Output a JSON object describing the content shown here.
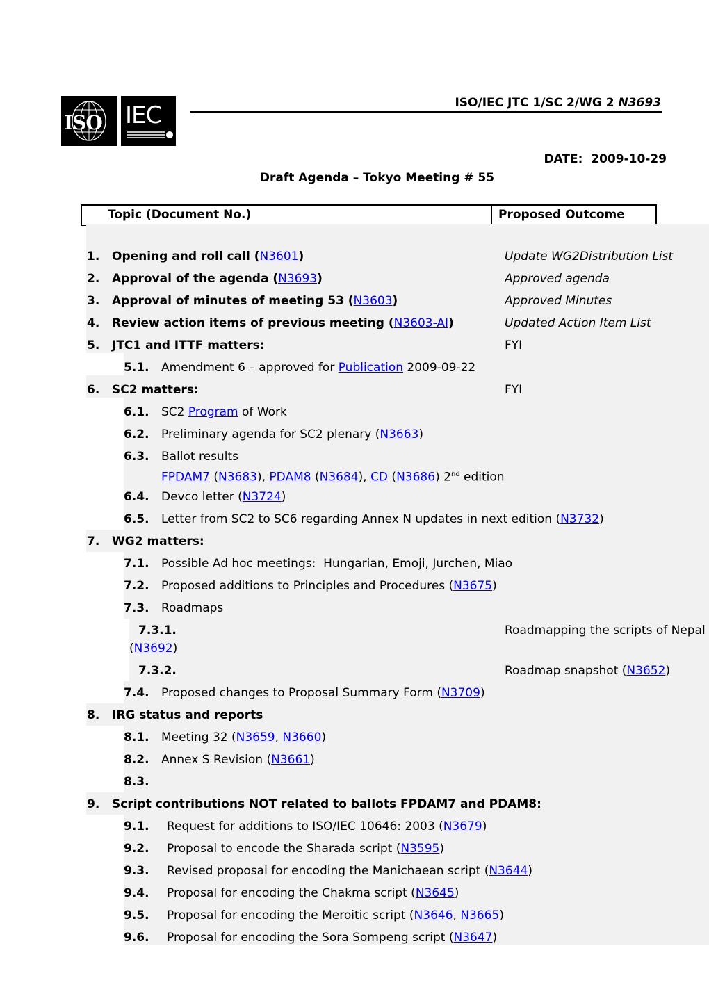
{
  "header": {
    "logos": [
      "ISO",
      "IEC"
    ],
    "doc_ref_prefix": "ISO/IEC JTC 1/SC 2/WG 2 ",
    "doc_ref_number": "N3693",
    "date_label": "DATE:",
    "date_value": "2009-10-29",
    "title": "Draft Agenda – Tokyo Meeting # 55"
  },
  "table_header": {
    "topic": "Topic (Document No.)",
    "outcome": "Proposed Outcome"
  },
  "colors": {
    "link": "#0000ee",
    "shade": "#f1f1f1"
  },
  "items": {
    "i1": {
      "num": "1.",
      "text": "Opening and roll call (",
      "link": "N3601",
      "close": ")",
      "outcome": "Update WG2Distribution List"
    },
    "i2": {
      "num": "2.",
      "text": "Approval of the agenda (",
      "link": "N3693",
      "close": ")",
      "outcome": "Approved agenda"
    },
    "i3": {
      "num": "3.",
      "text": "Approval of minutes of meeting 53 (",
      "link": "N3603",
      "close": ")",
      "outcome": "Approved Minutes"
    },
    "i4": {
      "num": "4.",
      "text": "Review action items of previous meeting (",
      "link": "N3603-AI",
      "close": ")",
      "outcome": "Updated Action Item List"
    },
    "i5": {
      "num": "5.",
      "text": "JTC1 and ITTF matters:",
      "outcome": "FYI"
    },
    "i5_1": {
      "num": "5.1.",
      "text": "Amendment 6 – approved for ",
      "link": "Publication",
      "after": " 2009-09-22"
    },
    "i6": {
      "num": "6.",
      "text": "SC2 matters:",
      "outcome": "FYI"
    },
    "i6_1": {
      "num": "6.1.",
      "text": "SC2 ",
      "link": "Program",
      "after": " of Work"
    },
    "i6_2": {
      "num": "6.2.",
      "text": "Preliminary agenda for SC2 plenary (",
      "link": "N3663",
      "close": ")"
    },
    "i6_3": {
      "num": "6.3.",
      "text": "Ballot results",
      "line2": {
        "l1": "FPDAM7",
        "l1d": "N3683",
        "l2": "PDAM8",
        "l2d": "N3684",
        "l3": "CD",
        "l3d": "N3686",
        "tail": " 2",
        "sup": "nd",
        "tail2": " edition"
      }
    },
    "i6_4": {
      "num": "6.4.",
      "text": "Devco letter (",
      "link": "N3724",
      "close": ")"
    },
    "i6_5": {
      "num": "6.5.",
      "text": "Letter from SC2 to SC6 regarding Annex N updates in next edition (",
      "link": "N3732",
      "close": ")"
    },
    "i7": {
      "num": "7.",
      "text": "WG2 matters:"
    },
    "i7_1": {
      "num": "7.1.",
      "text": "Possible Ad hoc meetings:  Hungarian, Emoji, Jurchen, Miao"
    },
    "i7_2": {
      "num": "7.2.",
      "text": "Proposed additions to Principles and Procedures (",
      "link": "N3675",
      "close": ")"
    },
    "i7_3": {
      "num": "7.3.",
      "text": "Roadmaps"
    },
    "i7_3_1": {
      "num": "7.3.1.",
      "text": "Roadmapping the scripts of Nepal",
      "open": "(",
      "link": "N3692",
      "close": ")"
    },
    "i7_3_2": {
      "num": "7.3.2.",
      "text": "Roadmap snapshot (",
      "link": "N3652",
      "close": ")"
    },
    "i7_4": {
      "num": "7.4.",
      "text": "Proposed changes to Proposal Summary Form (",
      "link": "N3709",
      "close": ")"
    },
    "i8": {
      "num": "8.",
      "text": "IRG status and reports"
    },
    "i8_1": {
      "num": "8.1.",
      "text": "Meeting 32 (",
      "link": "N3659",
      "sep": ", ",
      "link2": "N3660",
      "close": ")"
    },
    "i8_2": {
      "num": "8.2.",
      "text": "Annex S Revision (",
      "link": "N3661",
      "close": ")"
    },
    "i8_3": {
      "num": "8.3."
    },
    "i9": {
      "num": "9.",
      "text": "Script contributions NOT related to ballots FPDAM7 and PDAM8:"
    },
    "i9_1": {
      "num": "9.1.",
      "text": "Request for additions to ISO/IEC 10646: 2003 (",
      "link": "N3679",
      "close": ")"
    },
    "i9_2": {
      "num": "9.2.",
      "text": "Proposal to encode the Sharada script (",
      "link": "N3595",
      "close": ")"
    },
    "i9_3": {
      "num": "9.3.",
      "text": "Revised proposal for encoding the Manichaean script (",
      "link": "N3644",
      "close": ")"
    },
    "i9_4": {
      "num": "9.4.",
      "text": "Proposal for encoding the Chakma script (",
      "link": "N3645",
      "close": ")"
    },
    "i9_5": {
      "num": "9.5.",
      "text": "Proposal for encoding the Meroitic script (",
      "link": "N3646",
      "sep": ", ",
      "link2": "N3665",
      "close": ")"
    },
    "i9_6": {
      "num": "9.6.",
      "text": "Proposal for encoding the Sora Sompeng script (",
      "link": "N3647",
      "close": ")"
    }
  }
}
